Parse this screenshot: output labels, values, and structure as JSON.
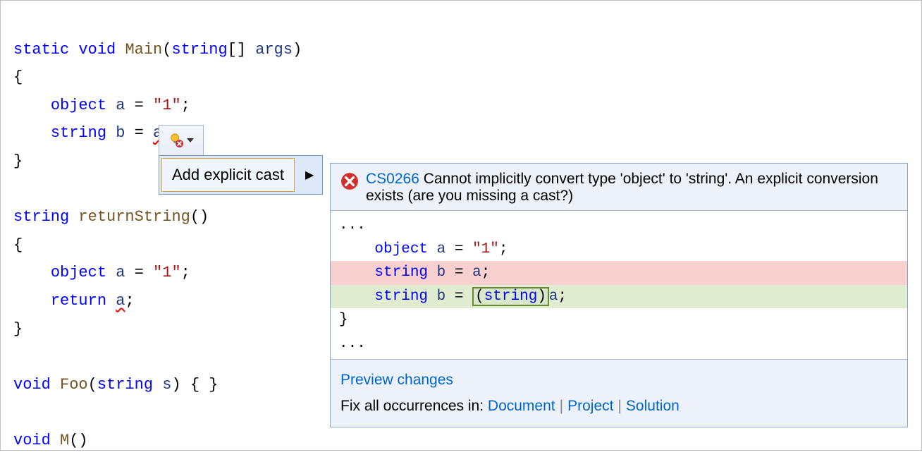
{
  "code": {
    "line1_static": "static",
    "line1_void": "void",
    "line1_main": "Main",
    "line1_string": "string",
    "line1_args": "args",
    "brace_open": "{",
    "brace_close": "}",
    "line3_object": "object",
    "line3_a": "a",
    "line3_eq": " = ",
    "line3_val": "\"1\"",
    "line3_semi": ";",
    "line4_string": "string",
    "line4_b": "b",
    "line4_eq": " = ",
    "line4_a": "a",
    "line4_semi": ";",
    "line7_string": "string",
    "line7_method": "returnString",
    "line7_parens": "()",
    "line9_object": "object",
    "line9_a": "a",
    "line9_val": "\"1\"",
    "line10_return": "return",
    "line10_a": "a",
    "line13_void": "void",
    "line13_foo": "Foo",
    "line13_string": "string",
    "line13_s": "s",
    "line13_body": ") { }",
    "line15_void": "void",
    "line15_m": "M",
    "line15_parens": "()"
  },
  "quickAction": {
    "label": "Add explicit cast"
  },
  "preview": {
    "errorCode": "CS0266",
    "errorText": "Cannot implicitly convert type 'object' to 'string'. An explicit conversion exists (are you missing a cast?)",
    "ellipsis": "...",
    "ctx_object": "object",
    "ctx_a": "a",
    "ctx_val": "\"1\"",
    "removed_string": "string",
    "removed_b": "b",
    "removed_a": "a",
    "added_string": "string",
    "added_b": "b",
    "added_cast_open": "(",
    "added_cast_type": "string",
    "added_cast_close": ")",
    "added_a": "a",
    "footer_preview": "Preview changes",
    "footer_fix": "Fix all occurrences in: ",
    "footer_doc": "Document",
    "footer_proj": "Project",
    "footer_sol": "Solution"
  }
}
